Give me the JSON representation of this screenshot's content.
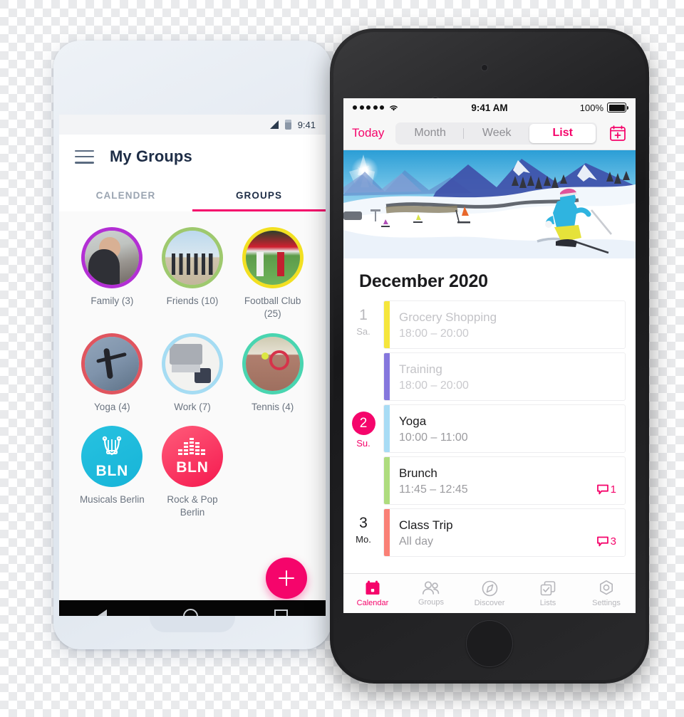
{
  "theme": {
    "accent_pink": "#f5056b",
    "android_title_color": "#1e2d46",
    "ios_muted": "#9b9b9f"
  },
  "android": {
    "status_bar": {
      "time": "9:41",
      "signal_icon": "signal-triangle-icon",
      "battery_icon": "battery-icon"
    },
    "app_bar": {
      "menu_icon": "hamburger-menu-icon",
      "title": "My Groups"
    },
    "tabs": [
      {
        "label": "CALENDER",
        "active": false
      },
      {
        "label": "GROUPS",
        "active": true
      }
    ],
    "groups": [
      {
        "name": "Family (3)",
        "ring": "#b32fd4",
        "art": "art-family",
        "kind": "photo"
      },
      {
        "name": "Friends (10)",
        "ring": "#9ec96e",
        "art": "art-friends",
        "kind": "photo"
      },
      {
        "name": "Football Club (25)",
        "ring": "#f2e021",
        "art": "art-football",
        "kind": "photo"
      },
      {
        "name": "Yoga (4)",
        "ring": "#e0555f",
        "art": "art-yoga",
        "kind": "photo"
      },
      {
        "name": "Work (7)",
        "ring": "#a5dcf3",
        "art": "art-work",
        "kind": "photo"
      },
      {
        "name": "Tennis (4)",
        "ring": "#49d5b0",
        "art": "art-tennis",
        "kind": "photo"
      },
      {
        "name": "Musicals Berlin",
        "logo_text": "BLN",
        "logo_class": "logo-musicals",
        "icon": "lyre-icon",
        "kind": "logo"
      },
      {
        "name": "Rock & Pop Berlin",
        "logo_text": "BLN",
        "logo_class": "logo-rock",
        "icon": "equalizer-icon",
        "kind": "logo"
      }
    ],
    "fab": {
      "icon": "plus-icon",
      "label": "Add group"
    },
    "nav_bar": {
      "back_icon": "back-triangle-icon",
      "home_icon": "home-circle-icon",
      "recents_icon": "recents-square-icon"
    }
  },
  "ios": {
    "status_bar": {
      "signal_icon": "signal-dots-icon",
      "wifi_icon": "wifi-icon",
      "time": "9:41 AM",
      "battery_percent": "100%",
      "battery_icon": "battery-icon"
    },
    "toolbar": {
      "today_label": "Today",
      "segments": [
        {
          "label": "Month",
          "active": false
        },
        {
          "label": "Week",
          "active": false
        },
        {
          "label": "List",
          "active": true
        }
      ],
      "add_icon": "calendar-plus-icon"
    },
    "hero": {
      "alt": "ski-slope-illustration"
    },
    "month_title": "December 2020",
    "events": [
      {
        "day": "1",
        "weekday": "Sa.",
        "day_state": "past",
        "title": "Grocery Shopping",
        "time": "18:00 – 20:00",
        "bar_color": "#f5e63c",
        "comments": null,
        "show_date": true
      },
      {
        "day": "",
        "weekday": "",
        "day_state": "past",
        "title": "Training",
        "time": "18:00 – 20:00",
        "bar_color": "#8577dd",
        "comments": null,
        "show_date": false
      },
      {
        "day": "2",
        "weekday": "Su.",
        "day_state": "today",
        "title": "Yoga",
        "time": "10:00 – 11:00",
        "bar_color": "#a8dcf5",
        "comments": null,
        "show_date": true
      },
      {
        "day": "",
        "weekday": "",
        "day_state": "none",
        "title": "Brunch",
        "time": "11:45 – 12:45",
        "bar_color": "#aedc7e",
        "comments": "1",
        "show_date": false
      },
      {
        "day": "3",
        "weekday": "Mo.",
        "day_state": "bold",
        "title": "Class Trip",
        "time": "All day",
        "bar_color": "#fa8076",
        "comments": "3",
        "show_date": true
      }
    ],
    "tab_bar": [
      {
        "label": "Calendar",
        "icon": "calendar-icon",
        "active": true
      },
      {
        "label": "Groups",
        "icon": "people-icon",
        "active": false
      },
      {
        "label": "Discover",
        "icon": "compass-icon",
        "active": false
      },
      {
        "label": "Lists",
        "icon": "checklist-icon",
        "active": false
      },
      {
        "label": "Settings",
        "icon": "gear-icon",
        "active": false
      }
    ]
  }
}
